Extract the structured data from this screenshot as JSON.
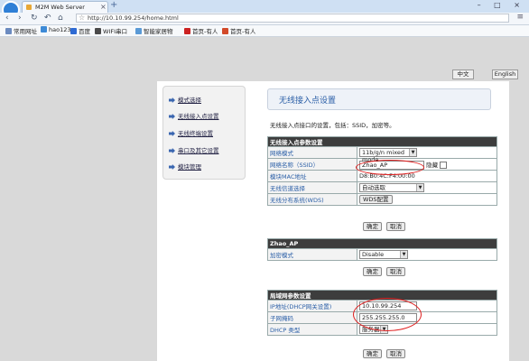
{
  "browser": {
    "tab_title": "M2M Web Server",
    "tab_close": "×",
    "new_tab": "+",
    "window_controls": "– □ ×",
    "url": "http://10.10.99.254/home.html",
    "nav_icons": [
      "back-icon",
      "forward-icon",
      "reload-icon",
      "undo-icon",
      "home-icon"
    ],
    "bookmarks": [
      {
        "label": "常用网址",
        "color": "#6b8bc0"
      },
      {
        "label": "hao123",
        "color": "#3d8ad6"
      },
      {
        "label": "百度",
        "color": "#2e6ad3"
      },
      {
        "label": "WIFI串口",
        "color": "#4a4a4a"
      },
      {
        "label": "智能家居物",
        "color": "#5a9ad6"
      },
      {
        "label": "首页-有人",
        "color": "#cc2222"
      },
      {
        "label": "首页-有人",
        "color": "#d24a2a"
      }
    ]
  },
  "lang": {
    "cn": "中文",
    "en": "English"
  },
  "sidebar": {
    "items": [
      {
        "label": "模式选择"
      },
      {
        "label": "无线接入点设置"
      },
      {
        "label": "无线终端设置"
      },
      {
        "label": "串口及其它设置"
      },
      {
        "label": "模块管理"
      }
    ]
  },
  "main": {
    "heading": "无线接入点设置",
    "description": "无线接入点接口的设置，包括：SSID，加密等。",
    "ap_table": {
      "header": "无线接入点参数设置",
      "rows": {
        "mode_label": "网络模式",
        "mode_value": "11b/g/n mixed mode",
        "ssid_label": "网络名称（SSID）",
        "ssid_value": "Zhao_AP",
        "hidden_label": "隐藏",
        "mac_label": "模块MAC地址",
        "mac_value": "D8:B0:4C:F4:00:00",
        "channel_label": "无线信道选择",
        "channel_value": "自动选取",
        "wds_label": "无线分布系统(WDS)",
        "wds_button": "WDS配置"
      }
    },
    "security_table": {
      "header": "Zhao_AP",
      "encryption_label": "加密模式",
      "encryption_value": "Disable"
    },
    "lan_table": {
      "header": "局域网参数设置",
      "ip_label": "IP地址(DHCP网关设置)",
      "ip_value": "10.10.99.254",
      "mask_label": "子网掩码",
      "mask_value": "255.255.255.0",
      "dhcp_label": "DHCP 类型",
      "dhcp_value": "服务器"
    },
    "confirm_label": "确定",
    "cancel_label": "取消"
  }
}
